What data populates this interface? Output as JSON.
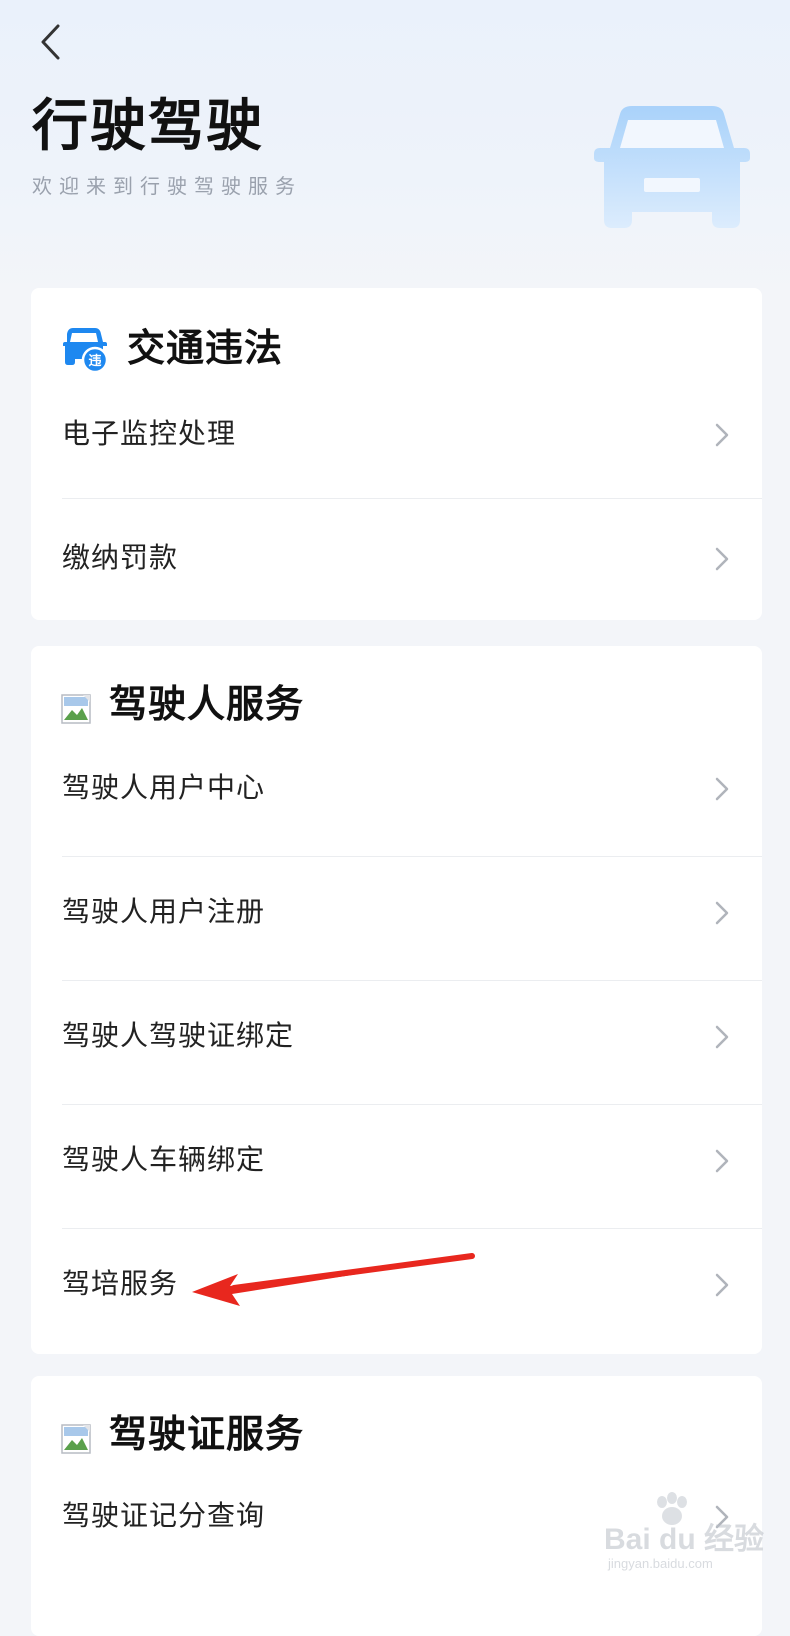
{
  "header": {
    "title": "行驶驾驶",
    "subtitle": "欢迎来到行驶驾驶服务"
  },
  "sections": [
    {
      "title": "交通违法",
      "icon": "violation-car-icon",
      "icon_badge": "违",
      "items": [
        {
          "label": "电子监控处理"
        },
        {
          "label": "缴纳罚款"
        }
      ]
    },
    {
      "title": "驾驶人服务",
      "icon": "broken-image-icon",
      "items": [
        {
          "label": "驾驶人用户中心"
        },
        {
          "label": "驾驶人用户注册"
        },
        {
          "label": "驾驶人驾驶证绑定"
        },
        {
          "label": "驾驶人车辆绑定"
        },
        {
          "label": "驾培服务"
        }
      ]
    },
    {
      "title": "驾驶证服务",
      "icon": "broken-image-icon",
      "items": [
        {
          "label": "驾驶证记分查询"
        }
      ]
    }
  ],
  "watermark": {
    "text": "Bai du 经验",
    "url": "jingyan.baidu.com"
  },
  "colors": {
    "accent": "#1e88f0",
    "car_light": "#bcdcfb",
    "arrow": "#e8271e"
  }
}
